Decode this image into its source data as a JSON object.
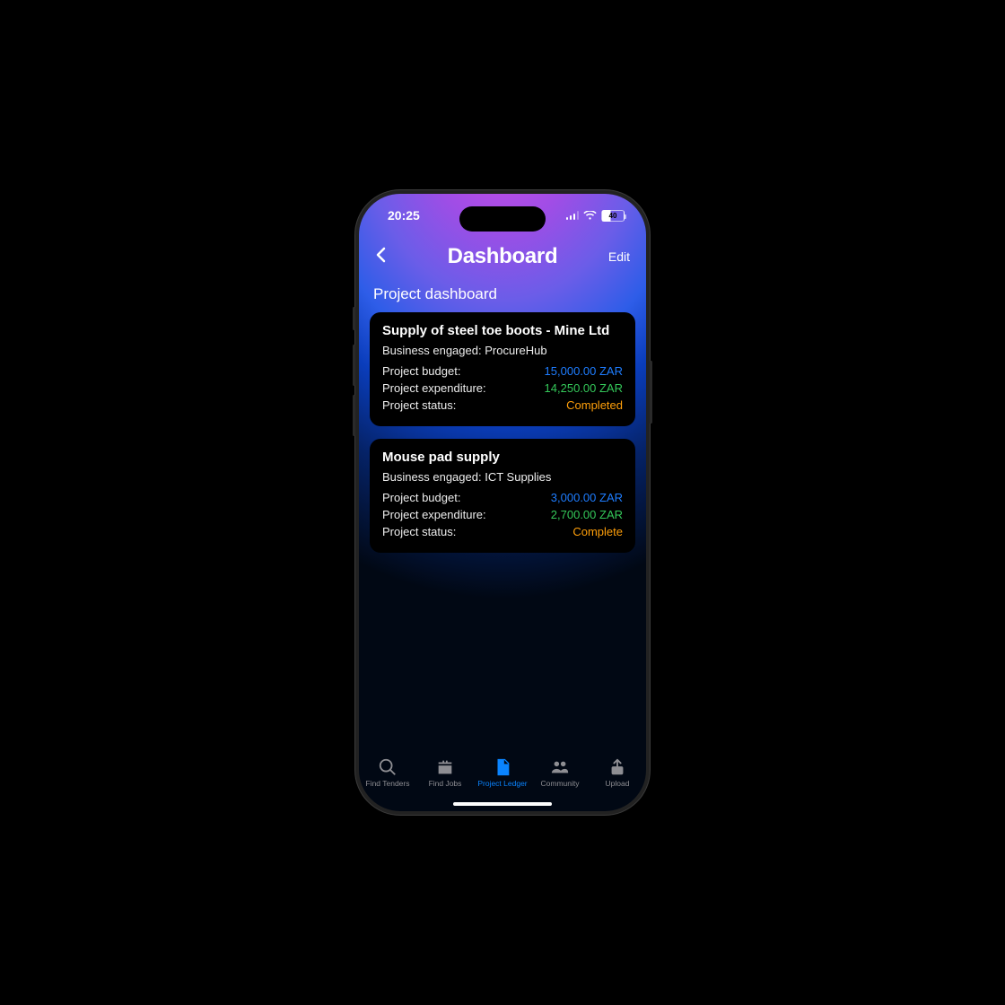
{
  "status": {
    "time": "20:25",
    "battery": "40"
  },
  "header": {
    "title": "Dashboard",
    "edit": "Edit"
  },
  "section": {
    "title": "Project dashboard"
  },
  "labels": {
    "biz": "Business engaged:",
    "budget": "Project budget:",
    "exp": "Project expenditure:",
    "status": "Project status:"
  },
  "projects": [
    {
      "title": "Supply of steel toe boots - Mine Ltd",
      "business": "ProcureHub",
      "budget": "15,000.00 ZAR",
      "expenditure": "14,250.00 ZAR",
      "status": "Completed"
    },
    {
      "title": "Mouse pad supply",
      "business": "ICT Supplies",
      "budget": "3,000.00 ZAR",
      "expenditure": "2,700.00 ZAR",
      "status": "Complete"
    }
  ],
  "tabs": [
    {
      "label": "Find Tenders"
    },
    {
      "label": "Find Jobs"
    },
    {
      "label": "Project Ledger"
    },
    {
      "label": "Community"
    },
    {
      "label": "Upload"
    }
  ]
}
